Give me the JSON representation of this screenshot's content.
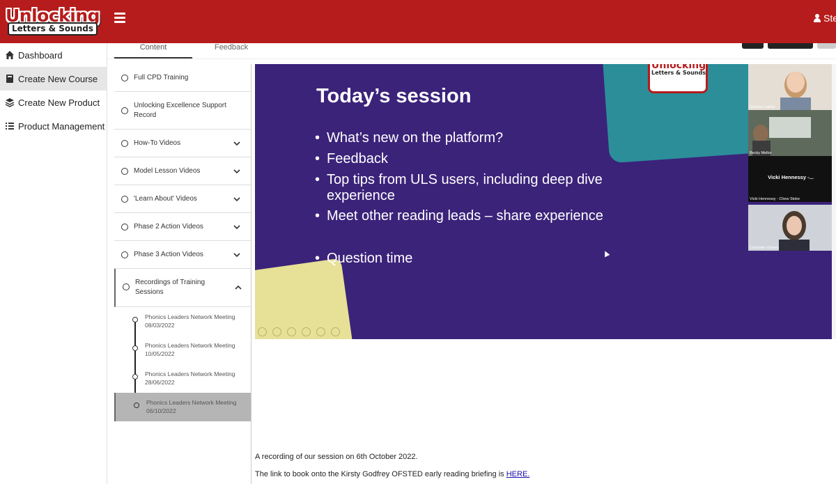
{
  "header": {
    "logo_line1": "Unlocking",
    "logo_line2": "Letters & Sounds",
    "user_label": "Ste"
  },
  "sidebar": {
    "items": [
      {
        "label": "Dashboard",
        "icon": "home-icon"
      },
      {
        "label": "Create New Course",
        "icon": "book-icon"
      },
      {
        "label": "Create New Product",
        "icon": "layers-icon"
      },
      {
        "label": "Product Management",
        "icon": "list-icon"
      }
    ]
  },
  "tabs": [
    "Content",
    "Feedback"
  ],
  "lessons": [
    {
      "label": "Full CPD Training"
    },
    {
      "label": "Unlocking Excellence Support Record"
    },
    {
      "label": "How-To Videos"
    },
    {
      "label": "Model Lesson Videos"
    },
    {
      "label": "'Learn About' Videos"
    },
    {
      "label": "Phase 2 Action Videos"
    },
    {
      "label": "Phase 3 Action Videos"
    },
    {
      "label": "Recordings of Training Sessions"
    }
  ],
  "sessions": [
    {
      "title": "Phonics Leaders Network Meeting",
      "date": "08/03/2022"
    },
    {
      "title": "Phonics Leaders Network Meeting",
      "date": "10/05/2022"
    },
    {
      "title": "Phonics Leaders Network Meeting",
      "date": "28/06/2022"
    },
    {
      "title": "Phonics Leaders Network Meeting",
      "date": "06/10/2022"
    }
  ],
  "slide": {
    "logo_line1": "Unlocking",
    "logo_line2": "Letters & Sounds",
    "title": "Today’s session",
    "bullets": [
      "What’s new on the platform?",
      "Feedback",
      "Top tips from ULS users, including deep dive experience",
      "Meet other reading leads – share experience",
      "Question time"
    ]
  },
  "participants": [
    {
      "name": "Gemma Larner"
    },
    {
      "name": "Becky Mellor"
    },
    {
      "name": "Vicki Hennessy - Chew Stoke",
      "display": "Vicki Hennessy -..."
    },
    {
      "name": "Charlotte Vickers"
    }
  ],
  "content": {
    "description": "A recording of our session on 6th October 2022.",
    "link_prefix": "The link to book onto the Kirsty Godfrey OFSTED early reading briefing is ",
    "link_text": "HERE."
  },
  "colors": {
    "brand_red": "#b71c1c",
    "slide_purple": "#3b237a",
    "slide_teal": "#2b8e99",
    "slide_yellow": "#e6e197"
  }
}
